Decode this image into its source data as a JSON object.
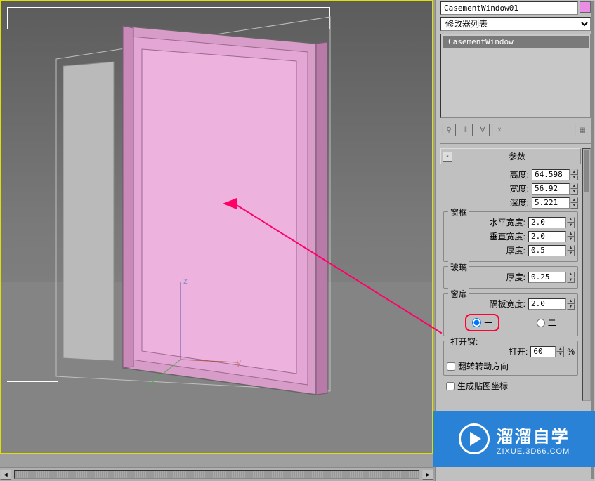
{
  "object_name": "CasementWindow01",
  "modifier_dropdown": "修改器列表",
  "stack": {
    "item": "CasementWindow"
  },
  "rollout": {
    "title": "参数",
    "toggle": "-",
    "height_label": "高度:",
    "height_value": "64.598",
    "width_label": "宽度:",
    "width_value": "56.92",
    "depth_label": "深度:",
    "depth_value": "5.221"
  },
  "frame_group": {
    "label": "窗框",
    "hwidth_label": "水平宽度:",
    "hwidth_value": "2.0",
    "vwidth_label": "垂直宽度:",
    "vwidth_value": "2.0",
    "thick_label": "厚度:",
    "thick_value": "0.5"
  },
  "glass_group": {
    "label": "玻璃",
    "thick_label": "厚度:",
    "thick_value": "0.25"
  },
  "sash_group": {
    "label": "窗扉",
    "panel_label": "隔板宽度:",
    "panel_value": "2.0",
    "radio_one": "一",
    "radio_two": "二"
  },
  "open_group": {
    "label": "打开窗:",
    "open_label": "打开:",
    "open_value": "60",
    "percent": "%",
    "flip_label": "翻转转动方向"
  },
  "uvw_label": "生成贴图坐标",
  "watermark": {
    "title": "溜溜自学",
    "url": "ZIXUE.3D66.COM"
  }
}
